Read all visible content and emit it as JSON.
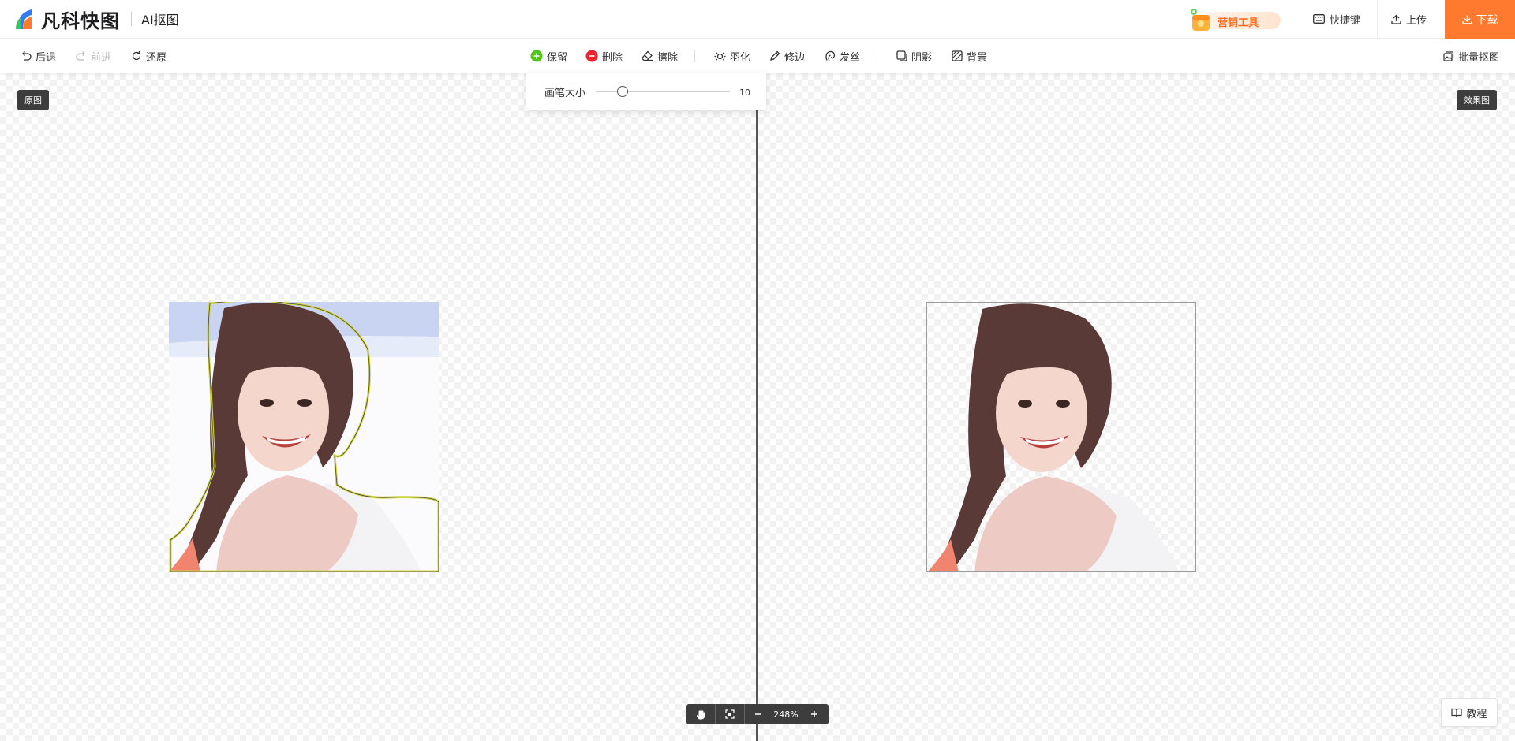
{
  "header": {
    "logo_text": "凡科快图",
    "app_name": "AI抠图",
    "marketing_label": "营销工具",
    "shortcuts_label": "快捷键",
    "upload_label": "上传",
    "download_label": "下载"
  },
  "toolbar": {
    "undo_label": "后退",
    "redo_label": "前进",
    "reset_label": "还原",
    "keep_label": "保留",
    "delete_label": "删除",
    "erase_label": "擦除",
    "feather_label": "羽化",
    "edge_label": "修边",
    "hair_label": "发丝",
    "shadow_label": "阴影",
    "background_label": "背景",
    "batch_label": "批量抠图"
  },
  "brush": {
    "label": "画笔大小",
    "value": "10",
    "fraction": 0.2
  },
  "canvas": {
    "original_tag": "原图",
    "result_tag": "效果图"
  },
  "zoom": {
    "value": "248%"
  },
  "tutorial_label": "教程",
  "colors": {
    "accent": "#ff7a2f",
    "keep": "#52c41a",
    "delete": "#f5222d",
    "selection_outline": "#d4d64a"
  }
}
